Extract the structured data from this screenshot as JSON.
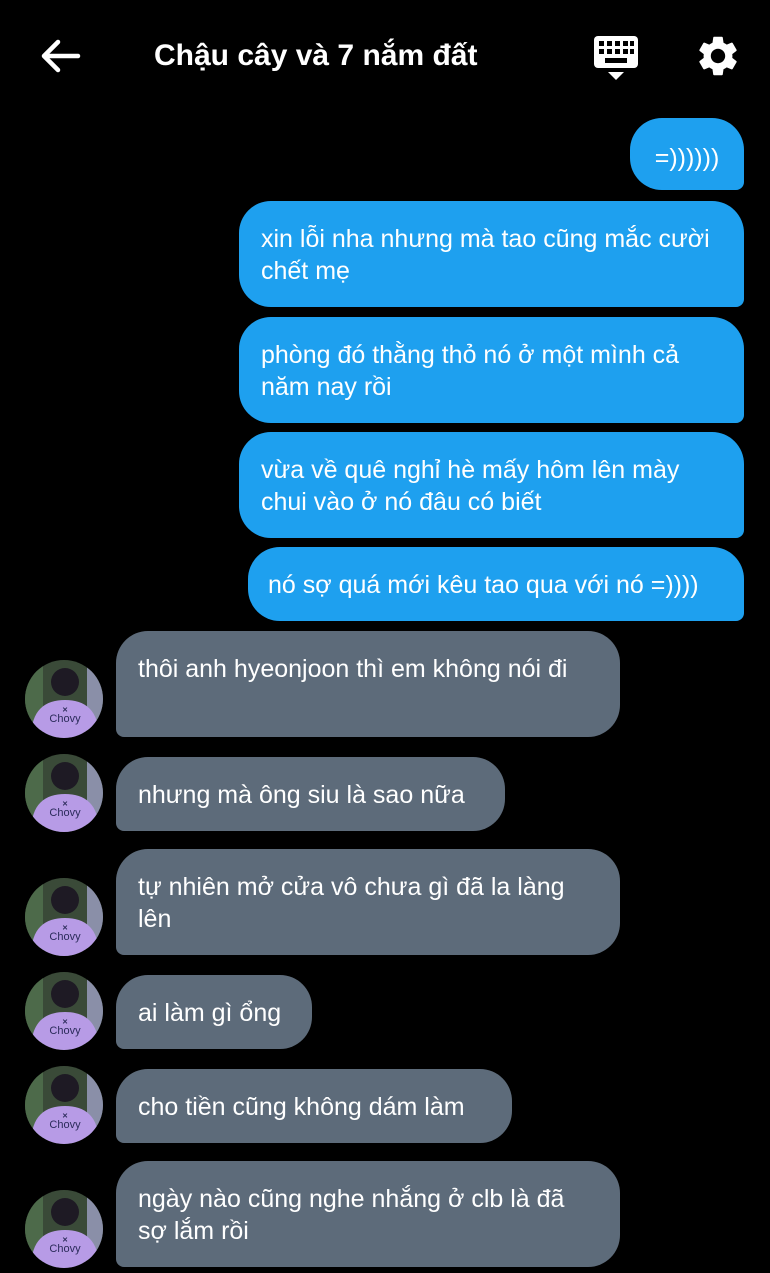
{
  "header": {
    "title": "Chậu cây và 7 nắm đất",
    "back_icon": "arrow-left-icon",
    "keyboard_icon": "keyboard-icon",
    "settings_icon": "gear-icon"
  },
  "avatar": {
    "shirt_text": "Chovy"
  },
  "messages": [
    {
      "from": "me",
      "text": "=))))))"
    },
    {
      "from": "me",
      "text": "xin lỗi nha nhưng mà tao cũng mắc cười chết mẹ"
    },
    {
      "from": "me",
      "text": "phòng đó thằng thỏ nó ở một mình cả năm nay rồi"
    },
    {
      "from": "me",
      "text": "vừa về quê nghỉ hè mấy hôm lên mày chui vào ở nó đâu có biết"
    },
    {
      "from": "me",
      "text": "nó sợ quá mới kêu tao qua với nó =))))"
    },
    {
      "from": "them",
      "text": "thôi anh hyeonjoon thì em không nói đi"
    },
    {
      "from": "them",
      "text": "nhưng mà ông siu là sao nữa"
    },
    {
      "from": "them",
      "text": "tự nhiên mở cửa vô chưa gì đã la làng lên"
    },
    {
      "from": "them",
      "text": "ai làm gì ổng"
    },
    {
      "from": "them",
      "text": "cho tiền cũng không dám làm"
    },
    {
      "from": "them",
      "text": "ngày nào cũng nghe nhắng ở clb là đã sợ lắm rồi"
    }
  ],
  "colors": {
    "background": "#000000",
    "sent_bubble": "#1ea0ef",
    "received_bubble": "#5d6b7a",
    "text": "#ffffff"
  }
}
